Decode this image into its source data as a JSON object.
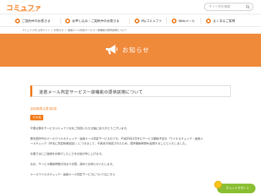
{
  "header": {
    "logo": "コミュファ",
    "logo_sub": "Powered by ctc",
    "search_placeholder": "サイト内を検索"
  },
  "nav": {
    "items": [
      {
        "label": "ご契約中のお客さま"
      },
      {
        "label": "お申し込み・ご契約中のお客さま"
      },
      {
        "label": "Myコミュファ"
      },
      {
        "label": "Webメール"
      },
      {
        "label": "よくあるご質問"
      }
    ]
  },
  "breadcrumb": "コミュファ光 公式サイト ＞ お知らせ ＞ 迷惑メール判定サービス一部機能の提供延期について",
  "banner": {
    "title": "お知らせ"
  },
  "article": {
    "title": "迷惑メール判定サービス一部機能の提供延期について",
    "date": "2008年1月30日",
    "tag": "その他",
    "paragraphs": [
      "平素は弊社サービスコミュファ光をご利用いただき誠にありがとうございます。",
      "弊社提供中のメールウイルスチェック・迷惑メール判定サービスのうち、平成20年1月中にサービス開始予定の「ウイルスチェック・迷惑メ",
      "ールチェック（件名に判定結果追加）」につきまして、不具合が発見されたため、提供開始時期を延期することといたしました。",
      "お客さまにご迷惑をお掛けしたことをお詫び申し上げます。",
      "なお、サービス開始時期が決まり次第、改めてお知らせいたします。",
      "メールウイルスチェック・迷惑メール判定サービスについてはこちら"
    ]
  },
  "chat": {
    "label": "チャットサポート"
  },
  "colors": {
    "accent": "#f27a1a",
    "banner": "#f08a3b",
    "chat": "#8bbf33"
  }
}
